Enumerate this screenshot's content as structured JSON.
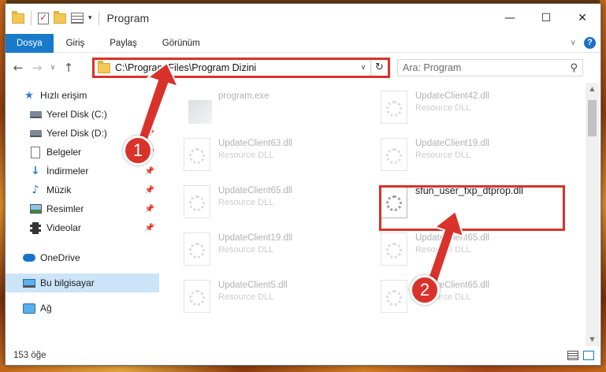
{
  "window": {
    "title": "Program",
    "controls": {
      "minimize": "—",
      "maximize": "☐",
      "close": "✕"
    }
  },
  "ribbon": {
    "tabs": [
      "Dosya",
      "Giriş",
      "Paylaş",
      "Görünüm"
    ],
    "active_tab": "Dosya",
    "help_label": "?"
  },
  "address": {
    "path": "C:\\Program Files\\Program Dizini",
    "search_placeholder": "Ara: Program"
  },
  "nav": {
    "items": [
      {
        "label": "Hızlı erişim",
        "icon": "star-icon",
        "pinned": false
      },
      {
        "label": "Yerel Disk (C:)",
        "icon": "disk-icon",
        "pinned": false
      },
      {
        "label": "Yerel Disk (D:)",
        "icon": "disk-icon",
        "pinned": true
      },
      {
        "label": "Belgeler",
        "icon": "documents-icon",
        "pinned": true
      },
      {
        "label": "İndirmeler",
        "icon": "download-icon",
        "pinned": true
      },
      {
        "label": "Müzik",
        "icon": "music-icon",
        "pinned": true
      },
      {
        "label": "Resimler",
        "icon": "pictures-icon",
        "pinned": true
      },
      {
        "label": "Videolar",
        "icon": "videos-icon",
        "pinned": true
      },
      {
        "label": "OneDrive",
        "icon": "cloud-icon",
        "pinned": false
      },
      {
        "label": "Bu bilgisayar",
        "icon": "computer-icon",
        "pinned": false,
        "selected": true
      },
      {
        "label": "Ağ",
        "icon": "network-icon",
        "pinned": false
      }
    ]
  },
  "files": [
    {
      "name": "program.exe",
      "type": "",
      "faded": true,
      "exe": true
    },
    {
      "name": "UpdateClient42.dll",
      "type": "Resource DLL",
      "faded": true
    },
    {
      "name": "UpdateClient63.dll",
      "type": "Resource DLL",
      "faded": true
    },
    {
      "name": "UpdateClient19.dll",
      "type": "Resource DLL",
      "faded": true
    },
    {
      "name": "UpdateClient65.dll",
      "type": "Resource DLL",
      "faded": true
    },
    {
      "name": "sfun_user_fxp_dtprop.dll",
      "type": "",
      "faded": false,
      "highlight": true
    },
    {
      "name": "UpdateClient19.dll",
      "type": "Resource DLL",
      "faded": true
    },
    {
      "name": "UpdateClient65.dll",
      "type": "Resource DLL",
      "faded": true
    },
    {
      "name": "UpdateClient5.dll",
      "type": "Resource DLL",
      "faded": true
    },
    {
      "name": "UpdateClient65.dll",
      "type": "Resource DLL",
      "faded": true
    }
  ],
  "status": {
    "count": "153 öğe"
  },
  "annotations": {
    "step1": "1",
    "step2": "2",
    "color": "#d9322b"
  }
}
